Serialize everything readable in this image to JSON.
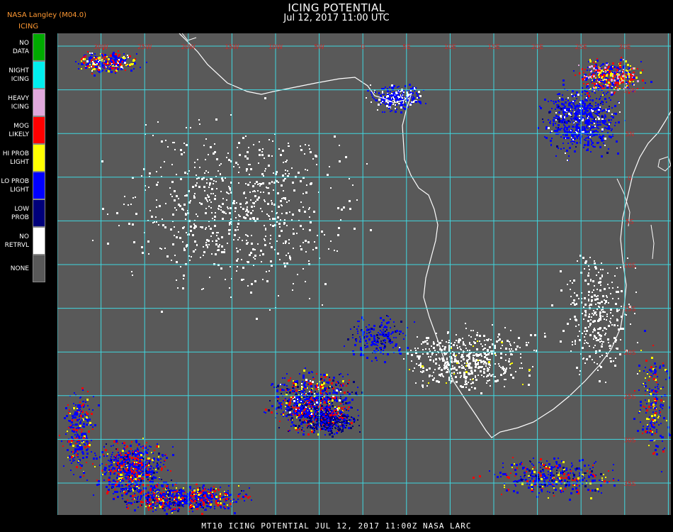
{
  "header": {
    "title": "ICING POTENTIAL",
    "datetime": "Jul 12, 2017 11:00 UTC",
    "source": "NASA Langley (M04.0)",
    "product": "ICING"
  },
  "legend": [
    {
      "label": "NO DATA",
      "color": "#00aa00"
    },
    {
      "label": "NIGHT ICING",
      "color": "#00eeee"
    },
    {
      "label": "HEAVY ICING",
      "color": "#e0a8dc"
    },
    {
      "label": "MOG LIKELY",
      "color": "#ff0000"
    },
    {
      "label": "HI PROB LIGHT",
      "color": "#ffff00"
    },
    {
      "label": "LO PROB LIGHT",
      "color": "#0000ff"
    },
    {
      "label": "LOW PROB",
      "color": "#00007a"
    },
    {
      "label": "NO RETRVL",
      "color": "#ffffff"
    },
    {
      "label": "NONE",
      "color": "#595959"
    }
  ],
  "map": {
    "background_color": "#595959",
    "grid_color": "#40d8e0",
    "label_color": "#cc2a2a",
    "coast_color": "#ffffff",
    "lon_labels": [
      "30W",
      "25W",
      "20W",
      "15W",
      "10W",
      "5W",
      "0",
      "5E",
      "10E",
      "15E",
      "20E",
      "25E",
      "30E"
    ],
    "lat_labels": [
      "10N",
      "5N",
      "0",
      "5S",
      "10S",
      "15S",
      "20S",
      "25S",
      "30S",
      "35S",
      "40S"
    ]
  },
  "footer": "MT10  ICING POTENTIAL   JUL 12, 2017 11:00Z   NASA LARC"
}
